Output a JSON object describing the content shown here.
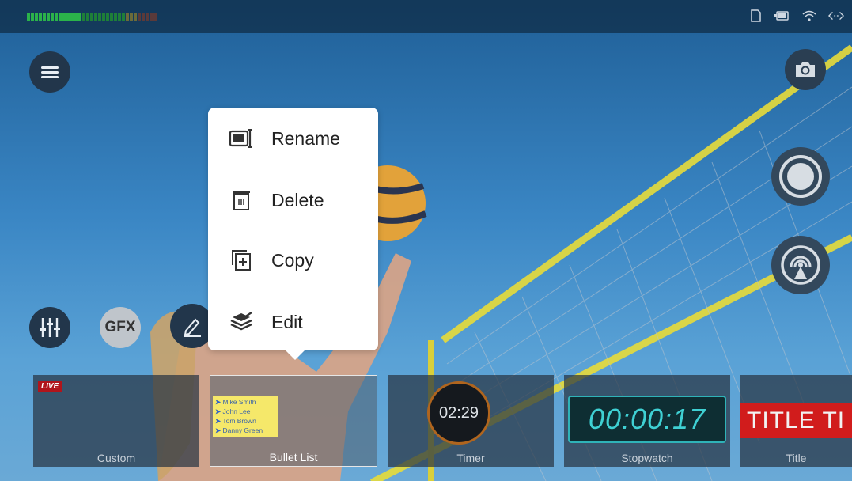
{
  "status_bar": {
    "meter_colors": [
      "#2bb34a",
      "#2bb34a",
      "#2bb34a",
      "#2bb34a",
      "#2bb34a",
      "#2bb34a",
      "#2bb34a",
      "#2bb34a",
      "#2bb34a",
      "#2bb34a",
      "#2bb34a",
      "#2bb34a",
      "#2bb34a",
      "#2bb34a",
      "#1e7f38",
      "#1e7f38",
      "#1e7f38",
      "#1e7f38",
      "#1e7f38",
      "#1e7f38",
      "#1e7f38",
      "#1e7f38",
      "#1e7f38",
      "#1e7f38",
      "#1e7f38",
      "#6b6b3a",
      "#6b6b3a",
      "#6b6b3a",
      "#5a3a3a",
      "#5a3a3a",
      "#5a3a3a",
      "#5a3a3a",
      "#5a3a3a"
    ],
    "icons": [
      "sd-card-icon",
      "battery-icon",
      "wifi-icon",
      "connection-icon"
    ]
  },
  "context_menu": {
    "items": [
      {
        "label": "Rename",
        "icon": "rename-icon"
      },
      {
        "label": "Delete",
        "icon": "trash-icon"
      },
      {
        "label": "Copy",
        "icon": "copy-icon"
      },
      {
        "label": "Edit",
        "icon": "edit-layers-icon"
      }
    ]
  },
  "toolbar": {
    "gfx_label": "GFX"
  },
  "thumbnails": [
    {
      "label": "Custom",
      "badge": "LIVE"
    },
    {
      "label": "Bullet List",
      "bullets": [
        "Mike Smith",
        "John Lee",
        "Tom Brown",
        "Danny Green"
      ]
    },
    {
      "label": "Timer",
      "time": "02:29"
    },
    {
      "label": "Stopwatch",
      "time": "00:00:17"
    },
    {
      "label": "Title",
      "text": "TITLE TI"
    }
  ],
  "colors": {
    "accent_live": "#b0151c",
    "lcd": "#3fd0d3",
    "title_red": "#d11c1c"
  }
}
